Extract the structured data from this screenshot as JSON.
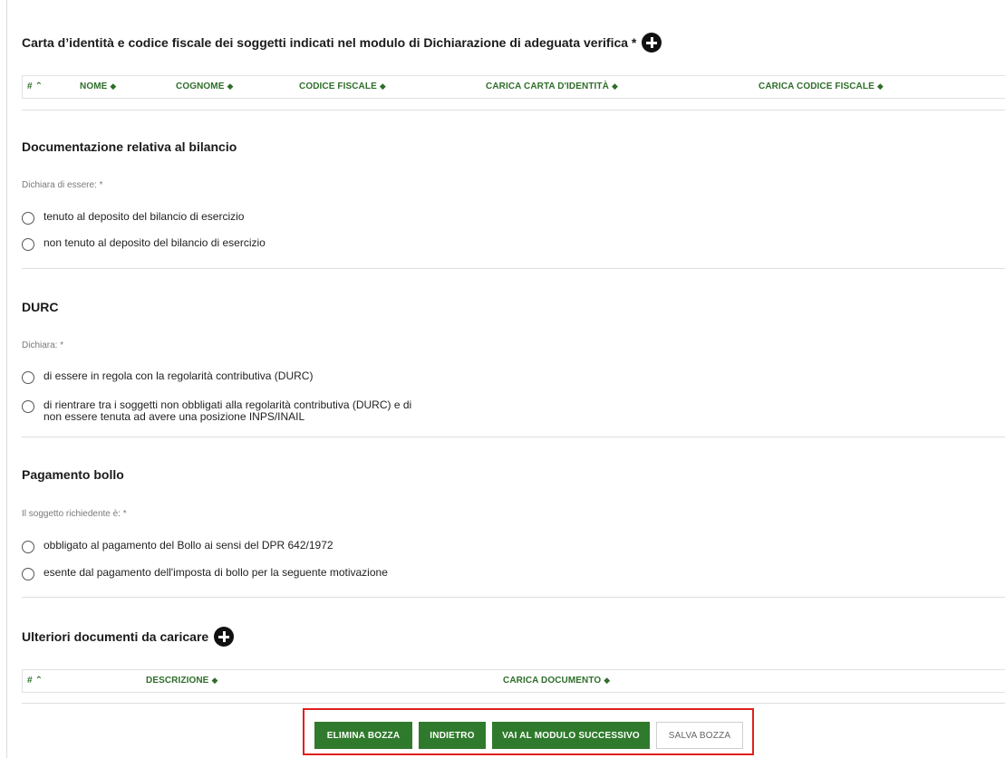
{
  "sections": {
    "identity": {
      "title": "Carta d’identità e codice fiscale dei soggetti indicati nel modulo di Dichiarazione di adeguata verifica *",
      "columns": [
        "#",
        "NOME",
        "COGNOME",
        "CODICE FISCALE",
        "CARICA CARTA D'IDENTITÀ",
        "CARICA CODICE FISCALE"
      ]
    },
    "bilancio": {
      "title": "Documentazione relativa al bilancio",
      "label": "Dichiara di essere: *",
      "options": [
        "tenuto al deposito del bilancio di esercizio",
        "non tenuto al deposito del bilancio di esercizio"
      ]
    },
    "durc": {
      "title": "DURC",
      "label": "Dichiara: *",
      "options": [
        "di essere in regola con la regolarità contributiva (DURC)",
        "di rientrare tra i soggetti non obbligati alla regolarità contributiva (DURC) e di",
        "non essere tenuta ad avere una posizione INPS/INAIL"
      ]
    },
    "bollo": {
      "title": "Pagamento bollo",
      "label": "Il soggetto richiedente è: *",
      "options": [
        "obbligato al pagamento del Bollo ai sensi del DPR 642/1972",
        "esente dal pagamento dell'imposta di bollo per la seguente motivazione"
      ]
    },
    "ulteriori": {
      "title": "Ulteriori documenti da caricare",
      "columns": [
        "#",
        "DESCRIZIONE",
        "CARICA DOCUMENTO"
      ]
    }
  },
  "icons": {
    "add": "plus-circle-icon",
    "sort": "sort-icon",
    "sort_up": "chevron-up-icon"
  },
  "buttons": {
    "delete_draft": "ELIMINA BOZZA",
    "back": "INDIETRO",
    "next_module": "VAI AL MODULO SUCCESSIVO",
    "save_draft": "SALVA BOZZA"
  },
  "colors": {
    "accent_green": "#2f7a2c",
    "header_green": "#2f6e2a",
    "highlight_red": "#e02020"
  }
}
